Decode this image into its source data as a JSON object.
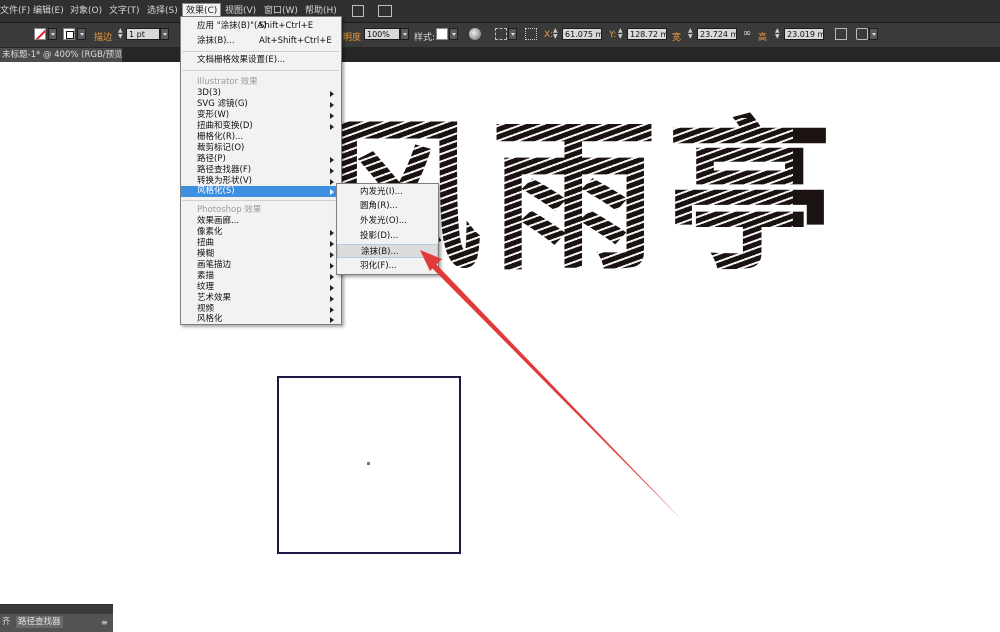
{
  "menubar": {
    "items": [
      "文件(F)",
      "编辑(E)",
      "对象(O)",
      "文字(T)",
      "选择(S)",
      "效果(C)",
      "视图(V)",
      "窗口(W)",
      "帮助(H)"
    ]
  },
  "controlbar": {
    "stroke_label": "描边",
    "stroke_weight": "1 pt",
    "opacity_label": "明度",
    "opacity_value": "100%",
    "style_label": "样式:",
    "x_label": "X:",
    "x_value": "61.075 mm",
    "y_label": "Y:",
    "y_value": "128.72 mm",
    "w_label": "宽",
    "w_value": "23.724 mm",
    "h_label": "高",
    "h_value": "23.019 mm"
  },
  "document": {
    "tab_title": "未标题-1* @ 400% (RGB/预览)"
  },
  "effect_menu": {
    "apply_last": "应用 \"涂抹(B)\"(A)",
    "apply_last_shortcut": "Shift+Ctrl+E",
    "last_effect": "涂抹(B)...",
    "last_effect_shortcut": "Alt+Shift+Ctrl+E",
    "raster_settings": "文档栅格效果设置(E)...",
    "illustrator_header": "Illustrator 效果",
    "illustrator_items": [
      "3D(3)",
      "SVG 滤镜(G)",
      "变形(W)",
      "扭曲和变换(D)",
      "栅格化(R)...",
      "裁剪标记(O)",
      "路径(P)",
      "路径查找器(F)",
      "转换为形状(V)",
      "风格化(S)"
    ],
    "photoshop_header": "Photoshop 效果",
    "photoshop_items": [
      "效果画廊...",
      "像素化",
      "扭曲",
      "模糊",
      "画笔描边",
      "素描",
      "纹理",
      "艺术效果",
      "视频",
      "风格化"
    ]
  },
  "stylize_submenu": {
    "items": [
      "内发光(I)...",
      "圆角(R)...",
      "外发光(O)...",
      "投影(D)...",
      "涂抹(B)...",
      "羽化(F)..."
    ]
  },
  "artwork": {
    "text": "风雨亭"
  },
  "bottom_panel": {
    "tabs": [
      "齐",
      "路径查找器"
    ]
  },
  "colors": {
    "menu_highlight": "#3d8fe0",
    "annotation_arrow": "#e03a3a",
    "artwork": "#1b1311"
  }
}
